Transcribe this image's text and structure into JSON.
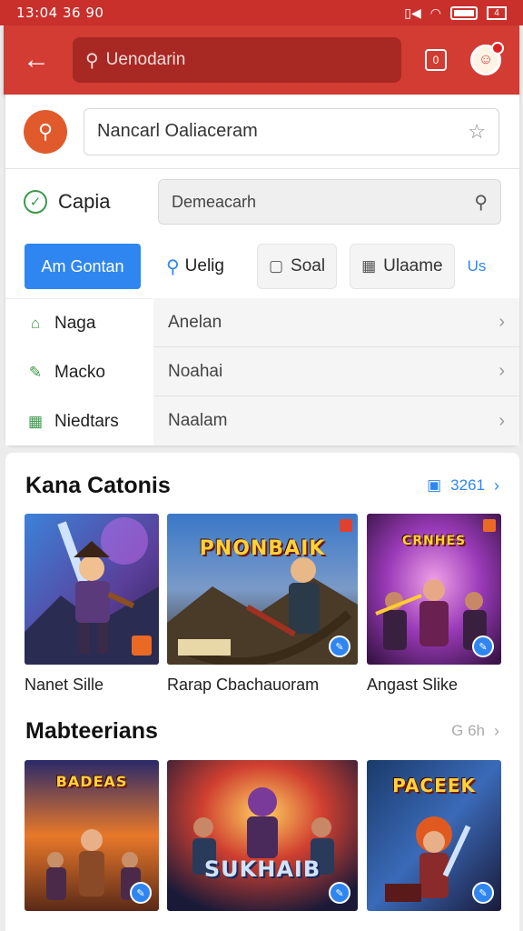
{
  "status_bar": {
    "time": "13:04 36 90",
    "battery_label": "4"
  },
  "app_bar": {
    "search_text": "Uenodarin",
    "square_label": "0"
  },
  "search_row": {
    "value": "Nancarl Oaliaceram"
  },
  "category_row": {
    "label": "Capia",
    "search_value": "Demeacarh"
  },
  "chips": {
    "primary": "Am Gontan",
    "plain": "Uelig",
    "box1": "Soal",
    "box2": "Ulaame",
    "link": "Us"
  },
  "nav": {
    "items": [
      {
        "label": "Naga",
        "icon": "home-icon"
      },
      {
        "label": "Macko",
        "icon": "edit-icon"
      },
      {
        "label": "Niedtars",
        "icon": "grid-icon"
      }
    ],
    "sub_items": [
      {
        "label": "Anelan"
      },
      {
        "label": "Noahai"
      },
      {
        "label": "Naalam"
      }
    ]
  },
  "section1": {
    "title": "Kana Catonis",
    "more": "3261",
    "cards": [
      {
        "label": "Nanet Sille"
      },
      {
        "label": "Rarap Cbachauoram",
        "art_title": "PNONBAIK"
      },
      {
        "label": "Angast Slike",
        "art_title": "CRNHES"
      }
    ]
  },
  "section2": {
    "title": "Mabteerians",
    "more": "G 6h",
    "cards": [
      {
        "label": "",
        "art_title": "BADEAS"
      },
      {
        "label": "",
        "art_title": "SUKHAIB"
      },
      {
        "label": "",
        "art_title": "PACEEK"
      }
    ]
  },
  "colors": {
    "app_bar": "#d23c32",
    "accent_blue": "#2f86f0",
    "accent_orange": "#e05a2b",
    "check_green": "#3c9a4a"
  }
}
